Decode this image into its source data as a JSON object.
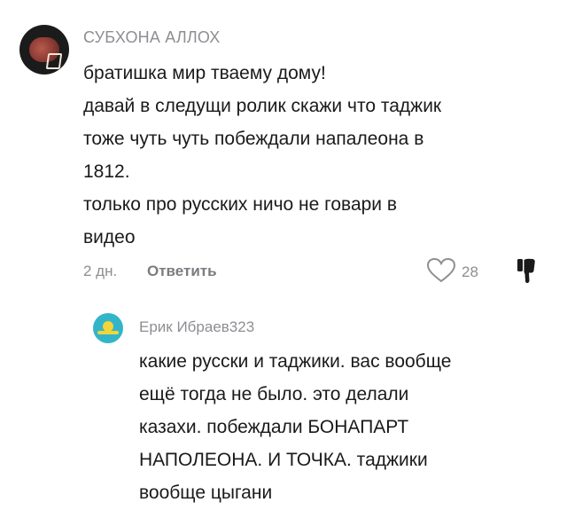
{
  "comment": {
    "username": "СУБХОНА АЛЛОХ",
    "lines": [
      "братишка мир тваему дому!",
      "давай в следущи ролик скажи что таджик",
      "тоже чуть чуть побеждали напалеона в",
      "1812.",
      "только про русских ничо не говари в",
      "видео"
    ],
    "date": "2 дн.",
    "reply_label": "Ответить",
    "likes": "28",
    "like_icon": "heart-outline-icon",
    "dislike_icon": "thumbs-down-icon"
  },
  "reply": {
    "username": "Ерик Ибраев323",
    "avatar_icon": "kazakhstan-flag-avatar",
    "lines": [
      "какие русски и таджики. вас вообще",
      "ещё тогда не было. это делали",
      "казахи. побеждали БОНАПАРТ",
      "НАПОЛЕОНА. И ТОЧКА. таджики",
      "вообще цыгани"
    ]
  },
  "colors": {
    "meta_gray": "#8e8e93",
    "text": "#1a1a1a",
    "reply_avatar": "#33b5c9"
  }
}
